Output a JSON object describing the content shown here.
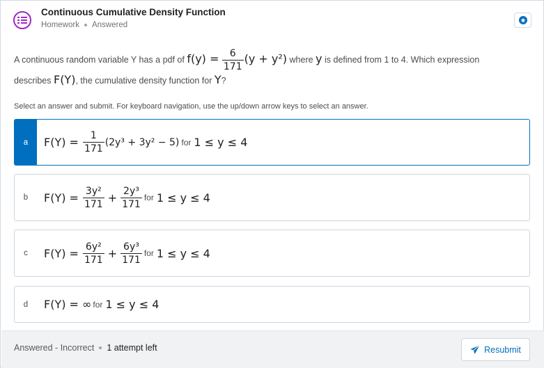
{
  "header": {
    "title": "Continuous Cumulative Density Function",
    "category": "Homework",
    "status": "Answered"
  },
  "question": {
    "text_before": "A continuous random variable Y has a pdf of ",
    "pdf_lhs": "f(y) =",
    "pdf_num": "6",
    "pdf_den": "171",
    "pdf_rhs": "(y + y²)",
    "text_where": " where ",
    "var_y": "y",
    "text_mid": " is defined from 1 to 4. Which expression",
    "text_line2": "describes ",
    "cdf_name": "F(Y)",
    "text_line2b": ", the cumulative density function for ",
    "var_Y": "Y",
    "text_end": "?"
  },
  "instructions": "Select an answer and submit. For keyboard navigation, use the up/down arrow keys to select an answer.",
  "options": [
    {
      "letter": "a",
      "lhs": "F(Y) =",
      "frac_num": "1",
      "frac_den": "171",
      "expr": "(2y³ + 3y² − 5)",
      "for": "for",
      "range": "1 ≤ y ≤ 4"
    },
    {
      "letter": "b",
      "lhs": "F(Y) =",
      "t1_num": "3y²",
      "t1_den": "171",
      "plus": "+",
      "t2_num": "2y³",
      "t2_den": "171",
      "for": "for",
      "range": "1 ≤ y ≤ 4"
    },
    {
      "letter": "c",
      "lhs": "F(Y) =",
      "t1_num": "6y²",
      "t1_den": "171",
      "plus": "+",
      "t2_num": "6y³",
      "t2_den": "171",
      "for": "for",
      "range": "1 ≤ y ≤ 4"
    },
    {
      "letter": "d",
      "lhs": "F(Y) = ∞",
      "for": "for",
      "range": "1 ≤ y ≤ 4"
    }
  ],
  "footer": {
    "result": "Answered - Incorrect",
    "attempts": "1 attempt left",
    "resubmit_label": "Resubmit"
  },
  "colors": {
    "accent": "#006fbf",
    "app_icon": "#a225c9",
    "footer_bg": "#f1f2f3"
  }
}
